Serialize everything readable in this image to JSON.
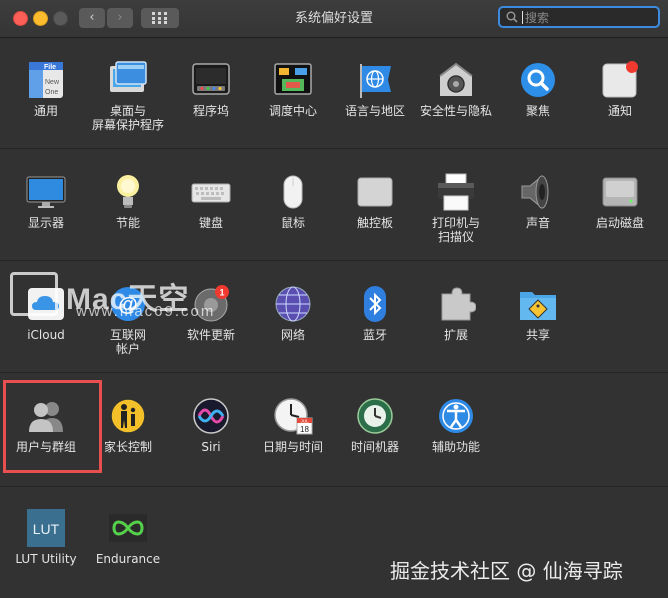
{
  "window": {
    "title": "系统偏好设置",
    "search_placeholder": "搜索",
    "back": "‹",
    "forward": "›"
  },
  "rows": [
    {
      "items": [
        {
          "label": "通用",
          "icon": "general-icon",
          "badge_text": "File\nNew\nOne"
        },
        {
          "label": "桌面与\n屏幕保护程序",
          "icon": "desktop-screensaver-icon"
        },
        {
          "label": "程序坞",
          "icon": "dock-icon"
        },
        {
          "label": "调度中心",
          "icon": "mission-control-icon"
        },
        {
          "label": "语言与地区",
          "icon": "language-region-icon"
        },
        {
          "label": "安全性与隐私",
          "icon": "security-privacy-icon"
        },
        {
          "label": "聚焦",
          "icon": "spotlight-icon"
        },
        {
          "label": "通知",
          "icon": "notifications-icon"
        }
      ]
    },
    {
      "items": [
        {
          "label": "显示器",
          "icon": "displays-icon"
        },
        {
          "label": "节能",
          "icon": "energy-saver-icon"
        },
        {
          "label": "键盘",
          "icon": "keyboard-icon"
        },
        {
          "label": "鼠标",
          "icon": "mouse-icon"
        },
        {
          "label": "触控板",
          "icon": "trackpad-icon"
        },
        {
          "label": "打印机与\n扫描仪",
          "icon": "printers-scanners-icon"
        },
        {
          "label": "声音",
          "icon": "sound-icon"
        },
        {
          "label": "启动磁盘",
          "icon": "startup-disk-icon"
        }
      ]
    },
    {
      "items": [
        {
          "label": "iCloud",
          "icon": "icloud-icon"
        },
        {
          "label": "互联网\n帐户",
          "icon": "internet-accounts-icon"
        },
        {
          "label": "软件更新",
          "icon": "software-update-icon",
          "badge": "1"
        },
        {
          "label": "网络",
          "icon": "network-icon"
        },
        {
          "label": "蓝牙",
          "icon": "bluetooth-icon"
        },
        {
          "label": "扩展",
          "icon": "extensions-icon"
        },
        {
          "label": "共享",
          "icon": "sharing-icon"
        }
      ]
    },
    {
      "items": [
        {
          "label": "用户与群组",
          "icon": "users-groups-icon"
        },
        {
          "label": "家长控制",
          "icon": "parental-controls-icon"
        },
        {
          "label": "Siri",
          "icon": "siri-icon"
        },
        {
          "label": "日期与时间",
          "icon": "date-time-icon",
          "calendar_month": "JUL",
          "calendar_day": "18"
        },
        {
          "label": "时间机器",
          "icon": "time-machine-icon"
        },
        {
          "label": "辅助功能",
          "icon": "accessibility-icon"
        }
      ]
    },
    {
      "items": [
        {
          "label": "LUT Utility",
          "icon": "lut-utility-icon",
          "icon_text": "LUT"
        },
        {
          "label": "Endurance",
          "icon": "endurance-icon"
        }
      ]
    }
  ],
  "watermarks": {
    "mac_logo": "Mac天空",
    "mac_url": "www.mac69.com",
    "footer": "掘金技术社区 @ 仙海寻踪"
  },
  "colors": {
    "background": "#323232",
    "highlight": "#e84f4f",
    "search_focus": "#3d8be0"
  }
}
